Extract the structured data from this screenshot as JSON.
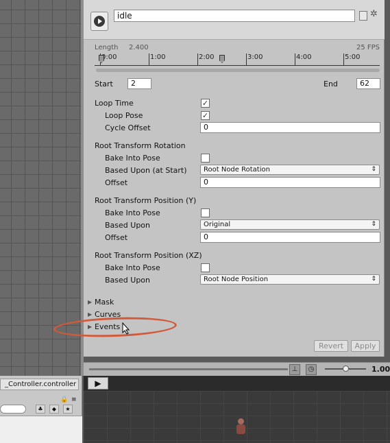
{
  "inspector": {
    "clip_name": "idle",
    "timeline": {
      "length_label": "Length",
      "length_value": "2.400",
      "fps": "25 FPS",
      "ticks": [
        "0:00",
        "1:00",
        "2:00",
        "3:00",
        "4:00",
        "5:00"
      ]
    },
    "start_label": "Start",
    "start_value": "2",
    "end_label": "End",
    "end_value": "62",
    "loop_time_label": "Loop Time",
    "loop_time_checked": true,
    "loop_pose_label": "Loop Pose",
    "loop_pose_checked": true,
    "cycle_offset_label": "Cycle Offset",
    "cycle_offset_value": "0",
    "rotation": {
      "heading": "Root Transform Rotation",
      "bake_label": "Bake Into Pose",
      "bake_checked": false,
      "based_upon_label": "Based Upon (at Start)",
      "based_upon_value": "Root Node Rotation",
      "offset_label": "Offset",
      "offset_value": "0"
    },
    "position_y": {
      "heading": "Root Transform Position (Y)",
      "bake_label": "Bake Into Pose",
      "bake_checked": false,
      "based_upon_label": "Based Upon",
      "based_upon_value": "Original",
      "offset_label": "Offset",
      "offset_value": "0"
    },
    "position_xz": {
      "heading": "Root Transform Position (XZ)",
      "bake_label": "Bake Into Pose",
      "bake_checked": false,
      "based_upon_label": "Based Upon",
      "based_upon_value": "Root Node Position"
    },
    "foldouts": [
      "Mask",
      "Curves",
      "Events"
    ],
    "revert_label": "Revert",
    "apply_label": "Apply"
  },
  "preview": {
    "speed_value": "1.00",
    "play_icon": "play-icon"
  },
  "project": {
    "tab_label": "_Controller.controller"
  },
  "colors": {
    "annotation": "#d05a3a",
    "inspector_bg": "#c4c4c4"
  }
}
